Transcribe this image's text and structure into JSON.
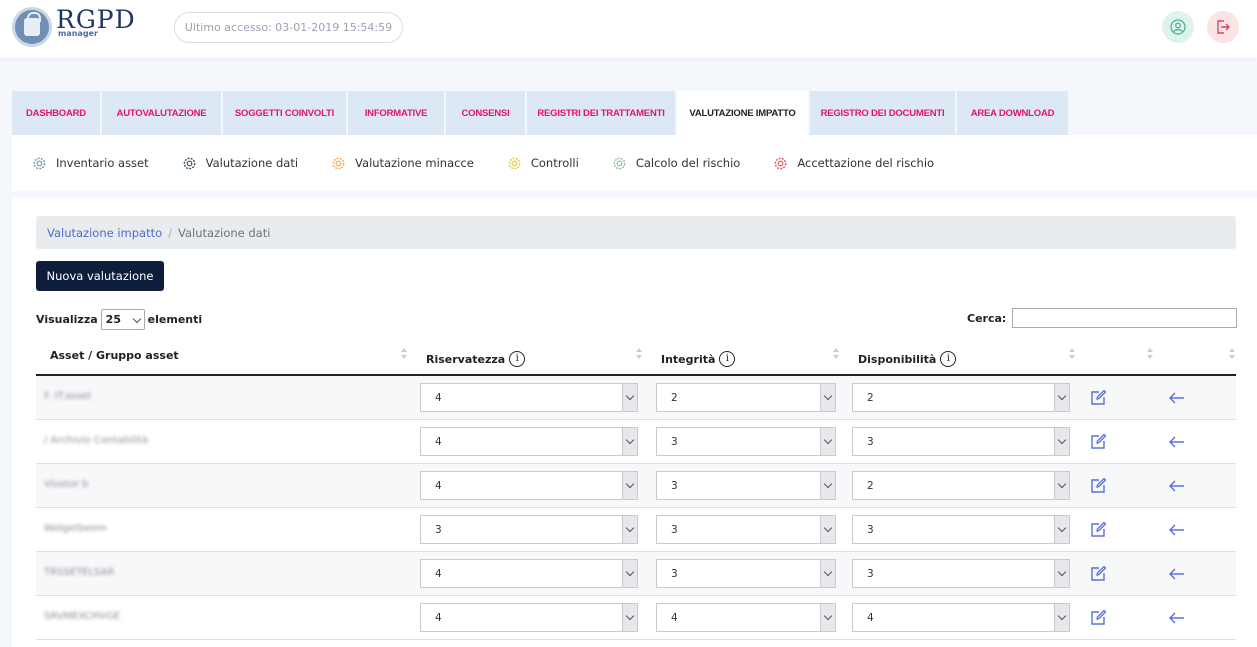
{
  "app": {
    "logo_title": "RGPD",
    "logo_subtitle": "manager",
    "last_access": "Ultimo accesso: 03-01-2019 15:54:59"
  },
  "tabs": [
    {
      "label": "DASHBOARD",
      "active": false
    },
    {
      "label": "AUTOVALUTAZIONE",
      "active": false
    },
    {
      "label": "SOGGETTI COINVOLTI",
      "active": false
    },
    {
      "label": "INFORMATIVE",
      "active": false
    },
    {
      "label": "CONSENSI",
      "active": false
    },
    {
      "label": "REGISTRI DEI TRATTAMENTI",
      "active": false
    },
    {
      "label": "VALUTAZIONE IMPATTO",
      "active": true
    },
    {
      "label": "REGISTRO DEI DOCUMENTI",
      "active": false
    },
    {
      "label": "AREA DOWNLOAD",
      "active": false
    }
  ],
  "subnav": [
    {
      "label": "Inventario asset",
      "icon": "gear-icon",
      "color": "#6b8fb5"
    },
    {
      "label": "Valutazione dati",
      "icon": "gear-icon",
      "color": "#2d4a5a"
    },
    {
      "label": "Valutazione minacce",
      "icon": "gear-icon",
      "color": "#f0a35e"
    },
    {
      "label": "Controlli",
      "icon": "gear-icon",
      "color": "#e8c23a"
    },
    {
      "label": "Calcolo del rischio",
      "icon": "gear-icon",
      "color": "#7cc47a"
    },
    {
      "label": "Accettazione del rischio",
      "icon": "gear-icon",
      "color": "#d9534f"
    }
  ],
  "breadcrumb": {
    "parent": "Valutazione impatto",
    "separator": "/",
    "current": "Valutazione dati"
  },
  "new_button": "Nuova valutazione",
  "length_menu": {
    "prefix": "Visualizza",
    "value": "25",
    "suffix": "elementi"
  },
  "search": {
    "label": "Cerca:",
    "value": ""
  },
  "table": {
    "columns": [
      "Asset / Gruppo asset",
      "Riservatezza",
      "Integrità",
      "Disponibilità"
    ],
    "info_icon": "i",
    "rows": [
      {
        "asset": "F. IT.ssset",
        "riservatezza": "4",
        "integrita": "2",
        "disponibilita": "2"
      },
      {
        "asset": "/ Archivio Contabilità",
        "riservatezza": "4",
        "integrita": "3",
        "disponibilita": "3"
      },
      {
        "asset": "Viostor b",
        "riservatezza": "4",
        "integrita": "3",
        "disponibilita": "2"
      },
      {
        "asset": "Wolgetbeem",
        "riservatezza": "3",
        "integrita": "3",
        "disponibilita": "3"
      },
      {
        "asset": "TRSSETELSAR",
        "riservatezza": "4",
        "integrita": "3",
        "disponibilita": "3"
      },
      {
        "asset": "SRVMEXCHVGE",
        "riservatezza": "4",
        "integrita": "4",
        "disponibilita": "4"
      }
    ]
  },
  "colors": {
    "accent": "#e0156e",
    "link": "#4d6ad6",
    "action": "#5b6ee1",
    "button_dark": "#0f1d3d"
  }
}
